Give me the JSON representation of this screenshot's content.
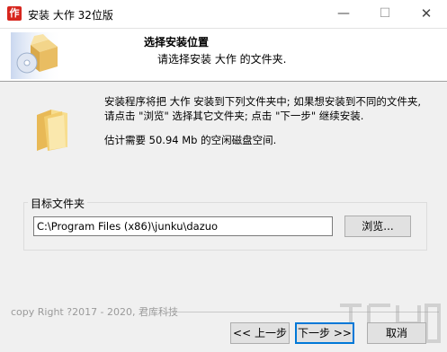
{
  "window": {
    "title": "安装 大作 32位版",
    "app_icon_glyph": "作",
    "minimize_glyph": "—",
    "maximize_glyph": "☐",
    "close_glyph": "✕"
  },
  "header": {
    "title": "选择安装位置",
    "subtitle": "请选择安装 大作 的文件夹."
  },
  "body": {
    "description": "安装程序将把 大作 安装到下列文件夹中; 如果想安装到不同的文件夹, 请点击 \"浏览\" 选择其它文件夹; 点击 \"下一步\" 继续安装.",
    "space_required": "估计需要 50.94 Mb 的空闲磁盘空间."
  },
  "destination": {
    "group_label": "目标文件夹",
    "path_value": "C:\\Program Files (x86)\\junku\\dazuo",
    "browse_label": "浏览..."
  },
  "footer": {
    "copyright": "copy Right  ?2017 - 2020, 君库科技",
    "back_label": "<< 上一步",
    "next_label": "下一步 >>",
    "cancel_label": "取消"
  },
  "icons": {
    "header": "installer-box-icon",
    "body": "folder-icon"
  },
  "colors": {
    "title_icon": "#d7261e",
    "default_button_border": "#0078d7",
    "dialog_bg": "#f0f0f0"
  }
}
